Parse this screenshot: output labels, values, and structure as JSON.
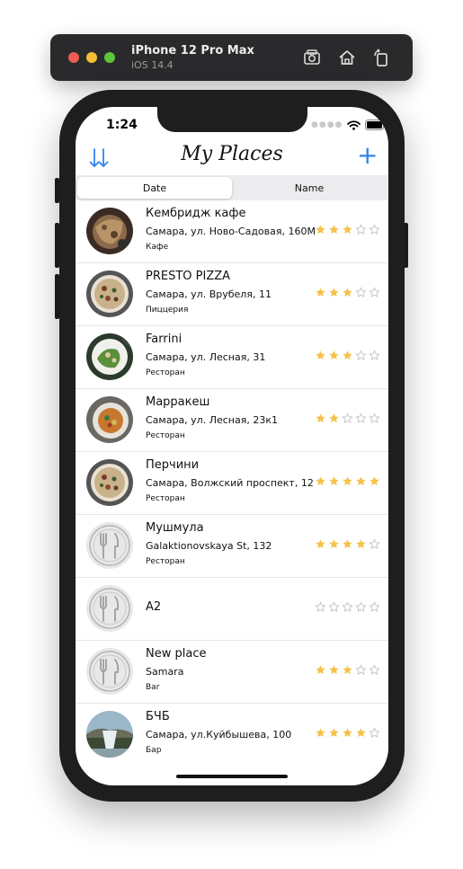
{
  "simulator": {
    "device_name": "iPhone 12 Pro Max",
    "os_version": "iOS 14.4"
  },
  "status_bar": {
    "time": "1:24"
  },
  "nav": {
    "title": "My Places",
    "add_label": "+"
  },
  "segment": {
    "options": [
      "Date",
      "Name"
    ],
    "selected": "Date"
  },
  "places": [
    {
      "name": "Кембридж кафе",
      "address": "Самара, ул. Ново-Садовая, 160М",
      "type": "Кафе",
      "rating": 3,
      "image": "food-photo"
    },
    {
      "name": "PRESTO PIZZA",
      "address": "Самара, ул. Врубеля, 11",
      "type": "Пиццерия",
      "rating": 3,
      "image": "pizza-photo"
    },
    {
      "name": "Farrini",
      "address": "Самара, ул. Лесная, 31",
      "type": "Ресторан",
      "rating": 3,
      "image": "salad-photo"
    },
    {
      "name": "Марракеш",
      "address": "Самара, ул. Лесная, 23к1",
      "type": "Ресторан",
      "rating": 2,
      "image": "bowl-photo"
    },
    {
      "name": "Перчини",
      "address": "Самара, Волжский проспект, 12",
      "type": "Ресторан",
      "rating": 5,
      "image": "pizza-photo"
    },
    {
      "name": "Мушмула",
      "address": "Galaktionovskaya St, 132",
      "type": "Ресторан",
      "rating": 4,
      "image": "fork-knife-placeholder"
    },
    {
      "name": "A2",
      "address": "",
      "type": "",
      "rating": 0,
      "image": "fork-knife-placeholder"
    },
    {
      "name": "New place",
      "address": "Samara",
      "type": "Bar",
      "rating": 3,
      "image": "fork-knife-placeholder"
    },
    {
      "name": "БЧБ",
      "address": "Самара, ул.Куйбышева, 100",
      "type": "Бар",
      "rating": 4,
      "image": "waterfall-photo"
    }
  ],
  "colors": {
    "accent": "#2f83f0",
    "star_filled": "#f5c24b",
    "star_empty": "#bdbdbd"
  }
}
